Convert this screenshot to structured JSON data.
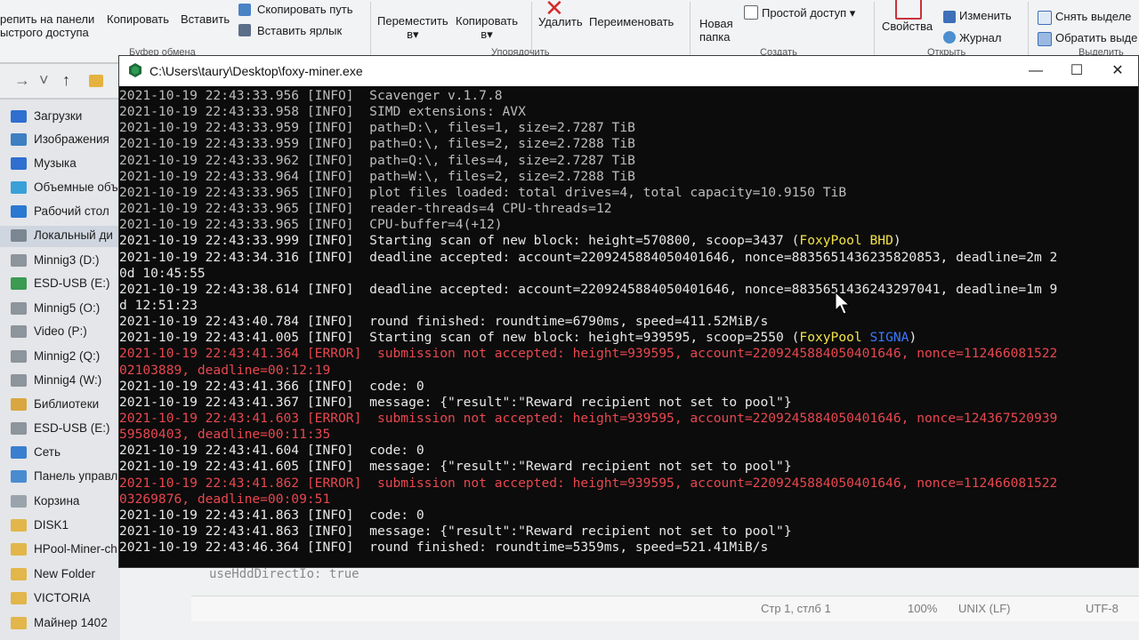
{
  "ribbon": {
    "pin_label": "репить на панели",
    "pin_label2": "ыстрого доступа",
    "copy_label": "Копировать",
    "paste_label": "Вставить",
    "copy_path_label": "Скопировать путь",
    "paste_shortcut_label": "Вставить ярлык",
    "clipboard_group": "Буфер обмена",
    "move_label": "Переместить",
    "move_label2": "в",
    "copyto_label": "Копировать",
    "copyto_label2": "в",
    "delete_label": "Удалить",
    "rename_label": "Переименовать",
    "organize_group": "Упорядочить",
    "new_folder_label": "Новая",
    "new_folder_label2": "папка",
    "easy_access_label": "Простой доступ",
    "create_group": "Создать",
    "properties_label": "Свойства",
    "edit_label": "Изменить",
    "journal_label": "Журнал",
    "open_group": "Открыть",
    "deselect_label": "Снять выделе",
    "invert_label": "Обратить выде",
    "select_group": "Выделить"
  },
  "sidebar": {
    "items": [
      {
        "label": "Загрузки",
        "color": "#2f6fcf"
      },
      {
        "label": "Изображения",
        "color": "#3d7fc2"
      },
      {
        "label": "Музыка",
        "color": "#2f6fcf"
      },
      {
        "label": "Объемные объ",
        "color": "#3aa0d8"
      },
      {
        "label": "Рабочий стол",
        "color": "#2a78d1"
      },
      {
        "label": "Локальный ди",
        "color": "#7a8793"
      },
      {
        "label": "Minnig3 (D:)",
        "color": "#8c949c"
      },
      {
        "label": "ESD-USB (E:)",
        "color": "#3c9a53"
      },
      {
        "label": "Minnig5 (O:)",
        "color": "#8c949c"
      },
      {
        "label": "Video (P:)",
        "color": "#8c949c"
      },
      {
        "label": "Minnig2 (Q:)",
        "color": "#8c949c"
      },
      {
        "label": "Minnig4 (W:)",
        "color": "#8c949c"
      },
      {
        "label": "Библиотеки",
        "color": "#d9a640"
      },
      {
        "label": "ESD-USB (E:)",
        "color": "#8c949c"
      },
      {
        "label": "Сеть",
        "color": "#3a7fcf"
      },
      {
        "label": "Панель управл",
        "color": "#4a8bd0"
      },
      {
        "label": "Корзина",
        "color": "#9aa3ab"
      },
      {
        "label": "DISK1",
        "color": "#e2b64a"
      },
      {
        "label": "HPool-Miner-ch",
        "color": "#e2b64a"
      },
      {
        "label": "New Folder",
        "color": "#e2b64a"
      },
      {
        "label": "VICTORIA",
        "color": "#e2b64a"
      },
      {
        "label": "Майнер 1402",
        "color": "#e2b64a"
      }
    ]
  },
  "editor": {
    "text": "useHddDirectIo: true",
    "status_position": "Стр 1, стлб 1",
    "status_zoom": "100%",
    "status_eol": "UNIX (LF)",
    "status_encoding": "UTF-8"
  },
  "console": {
    "title": "C:\\Users\\taury\\Desktop\\foxy-miner.exe",
    "minimize": "—",
    "maximize": "☐",
    "close": "✕",
    "lines": [
      "2021-10-19 22:43:33.956 [INFO]  Scavenger v.1.7.8",
      "2021-10-19 22:43:33.958 [INFO]  SIMD extensions: AVX",
      "2021-10-19 22:43:33.959 [INFO]  path=D:\\, files=1, size=2.7287 TiB",
      "2021-10-19 22:43:33.959 [INFO]  path=O:\\, files=2, size=2.7288 TiB",
      "2021-10-19 22:43:33.962 [INFO]  path=Q:\\, files=4, size=2.7287 TiB",
      "2021-10-19 22:43:33.964 [INFO]  path=W:\\, files=2, size=2.7288 TiB",
      "2021-10-19 22:43:33.965 [INFO]  plot files loaded: total drives=4, total capacity=10.9150 TiB",
      "2021-10-19 22:43:33.965 [INFO]  reader-threads=4 CPU-threads=12",
      "2021-10-19 22:43:33.965 [INFO]  CPU-buffer=4(+12)",
      "2021-10-19 22:43:33.999 [INFO]  Starting scan of new block: height=570800, scoop=3437 (",
      "2021-10-19 22:43:34.316 [INFO]  deadline accepted: account=2209245884050401646, nonce=8835651436235820853, deadline=2m 2",
      "0d 10:45:55",
      "2021-10-19 22:43:38.614 [INFO]  deadline accepted: account=2209245884050401646, nonce=8835651436243297041, deadline=1m 9",
      "d 12:51:23",
      "2021-10-19 22:43:40.784 [INFO]  round finished: roundtime=6790ms, speed=411.52MiB/s",
      "2021-10-19 22:43:41.005 [INFO]  Starting scan of new block: height=939595, scoop=2550 (",
      "2021-10-19 22:43:41.364 [ERROR]  submission not accepted: height=939595, account=2209245884050401646, nonce=112466081522",
      "02103889, deadline=00:12:19",
      "2021-10-19 22:43:41.366 [INFO]  code: 0",
      "2021-10-19 22:43:41.367 [INFO]  message: {\"result\":\"Reward recipient not set to pool\"}",
      "2021-10-19 22:43:41.603 [ERROR]  submission not accepted: height=939595, account=2209245884050401646, nonce=124367520939",
      "59580403, deadline=00:11:35",
      "2021-10-19 22:43:41.604 [INFO]  code: 0",
      "2021-10-19 22:43:41.605 [INFO]  message: {\"result\":\"Reward recipient not set to pool\"}",
      "2021-10-19 22:43:41.862 [ERROR]  submission not accepted: height=939595, account=2209245884050401646, nonce=112466081522",
      "03269876, deadline=00:09:51",
      "2021-10-19 22:43:41.863 [INFO]  code: 0",
      "2021-10-19 22:43:41.863 [INFO]  message: {\"result\":\"Reward recipient not set to pool\"}",
      "2021-10-19 22:43:46.364 [INFO]  round finished: roundtime=5359ms, speed=521.41MiB/s"
    ],
    "pool_bhd_name": "FoxyPool",
    "pool_bhd_coin": "BHD",
    "pool_signa_name": "FoxyPool",
    "pool_signa_coin": "SIGNA",
    "colors": {
      "info": "#e8e8e8",
      "error": "#e8474f",
      "highlight_yellow": "#f3e34a",
      "highlight_blue": "#3b78ff"
    }
  }
}
